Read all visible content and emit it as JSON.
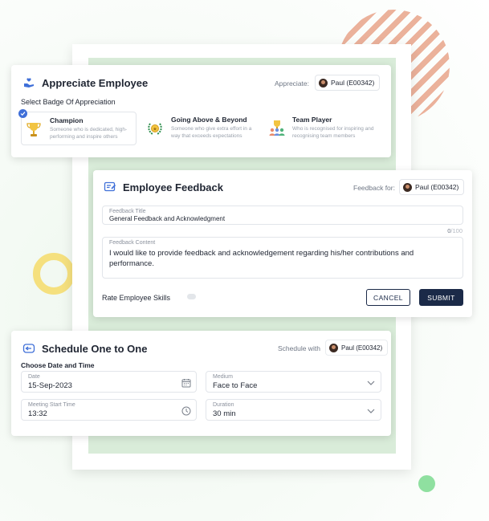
{
  "appreciate": {
    "title": "Appreciate Employee",
    "appreciate_label": "Appreciate:",
    "employee": "Paul (E00342)",
    "select_badge_label": "Select Badge Of Appreciation",
    "badges": [
      {
        "title": "Champion",
        "desc": "Someone who is dedicated, high-performing and inspire others",
        "icon": "trophy-icon",
        "selected": true
      },
      {
        "title": "Going Above & Beyond",
        "desc": "Someone who give extra effort in a way that exceeds expectations",
        "icon": "laurel-medal-icon",
        "selected": false
      },
      {
        "title": "Team Player",
        "desc": "Who is recognised for inspiring and recognising team members",
        "icon": "team-trophy-icon",
        "selected": false
      }
    ]
  },
  "feedback": {
    "title": "Employee Feedback",
    "feedback_for_label": "Feedback for:",
    "employee": "Paul (E00342)",
    "title_field_label": "Feedback Title",
    "title_field_value": "General Feedback and Acknowledgment",
    "char_count": "0",
    "char_max": "/100",
    "content_label": "Feedback Content",
    "content_value": "I would like to provide feedback and acknowledgement regarding his/her contributions and performance.",
    "rate_skills_label": "Rate Employee Skills",
    "rate_toggle_on": false,
    "cancel_label": "CANCEL",
    "submit_label": "SUBMIT"
  },
  "schedule": {
    "title": "Schedule One to One",
    "schedule_with_label": "Schedule with",
    "employee": "Paul (E00342)",
    "section_label": "Choose Date and Time",
    "date_label": "Date",
    "date_value": "15-Sep-2023",
    "medium_label": "Medium",
    "medium_value": "Face to Face",
    "time_label": "Meeting Start Time",
    "time_value": "13:32",
    "duration_label": "Duration",
    "duration_value": "30 min"
  },
  "colors": {
    "navy": "#1b2a48",
    "accent_blue": "#3f6fd8",
    "green_panel": "#d9ecd9"
  }
}
